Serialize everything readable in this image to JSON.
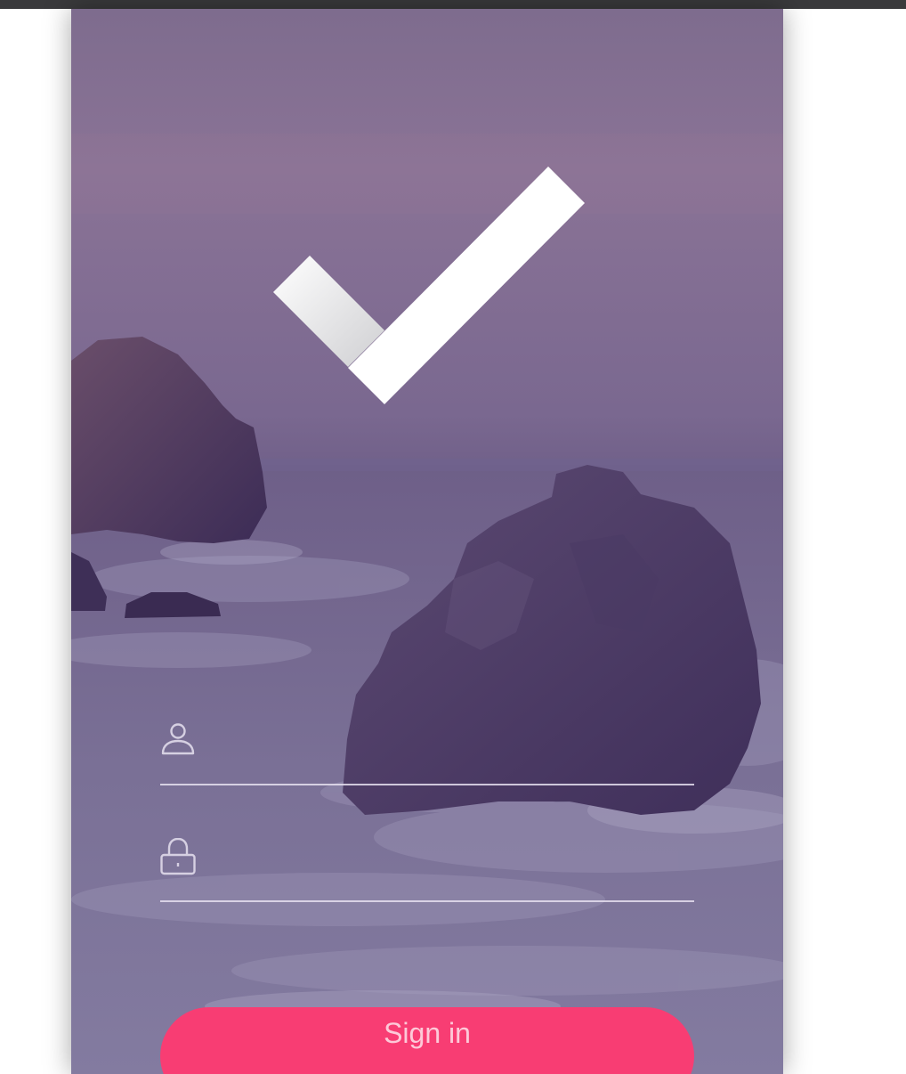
{
  "login": {
    "username_placeholder": "",
    "password_placeholder": "",
    "signin_label": "Sign in"
  },
  "icons": {
    "logo": "checkmark-logo-icon",
    "username": "person-icon",
    "password": "lock-icon"
  },
  "colors": {
    "overlay": "#7a6890",
    "button": "#f83d73",
    "underline": "#e6e1f0",
    "logo": "#ffffff"
  }
}
